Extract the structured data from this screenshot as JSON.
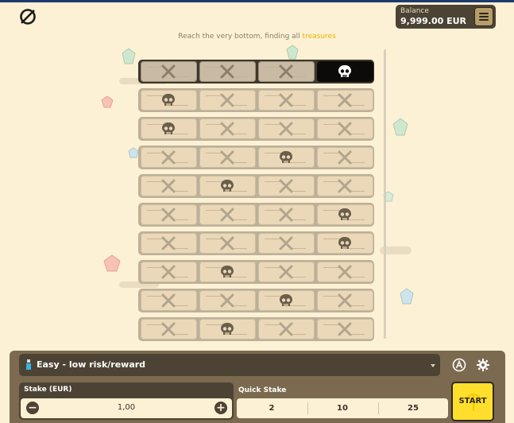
{
  "header": {
    "logo_icon": "slashed-circle-logo-icon",
    "balance_label": "Balance",
    "balance_value": "9,999.00 EUR",
    "menu_icon": "hamburger-menu-icon"
  },
  "instruction": {
    "prefix": "Reach the very bottom, finding all",
    "highlight": "treasures"
  },
  "board": {
    "rows": [
      [
        "x",
        "x",
        "x",
        "skull-dark"
      ],
      [
        "skull",
        "x",
        "x",
        "x"
      ],
      [
        "skull",
        "x",
        "x",
        "x"
      ],
      [
        "x",
        "x",
        "skull",
        "x"
      ],
      [
        "x",
        "skull",
        "x",
        "x"
      ],
      [
        "x",
        "x",
        "x",
        "skull"
      ],
      [
        "x",
        "x",
        "x",
        "skull"
      ],
      [
        "x",
        "skull",
        "x",
        "x"
      ],
      [
        "x",
        "x",
        "skull",
        "x"
      ],
      [
        "x",
        "skull",
        "x",
        "x"
      ]
    ],
    "revealed_row": 0
  },
  "controls": {
    "mode_label": "Easy - low risk/reward",
    "auto_icon": "autoplay-icon",
    "settings_icon": "gear-icon",
    "stake_label": "Stake (EUR)",
    "stake_value": "1,00",
    "minus": "−",
    "plus": "+",
    "quick_label": "Quick Stake",
    "quick_values": [
      "2",
      "10",
      "25"
    ],
    "start_label": "START"
  },
  "colors": {
    "background": "#fdf1d5",
    "panel": "#7b6a4f",
    "dark": "#4d4334",
    "start": "#ffdf2b",
    "highlight": "#e9b300"
  }
}
